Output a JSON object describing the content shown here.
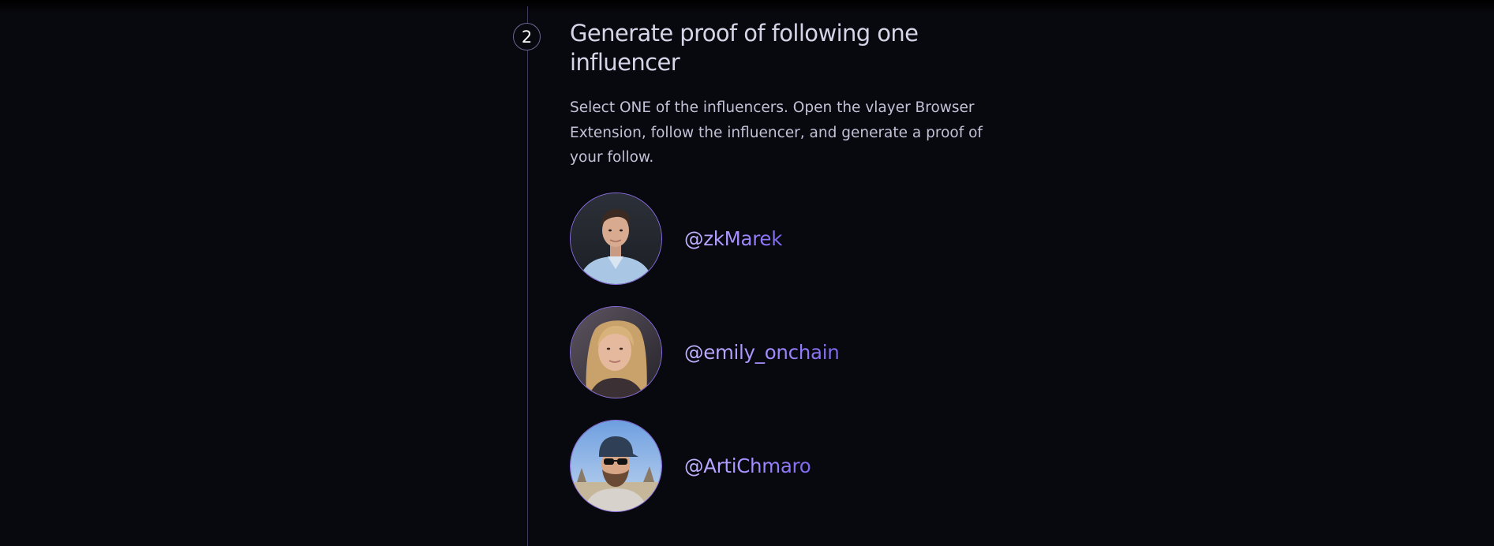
{
  "step": {
    "number": "2",
    "title": "Generate proof of following one influencer",
    "description": "Select ONE of the influencers. Open the vlayer Browser Extension, follow the influencer, and generate a proof of your follow."
  },
  "influencers": [
    {
      "handle": "@zkMarek",
      "avatar_icon": "avatar-photo"
    },
    {
      "handle": "@emily_onchain",
      "avatar_icon": "avatar-photo"
    },
    {
      "handle": "@ArtiChmaro",
      "avatar_icon": "avatar-photo"
    }
  ],
  "colors": {
    "background": "#08080f",
    "accent": "#a58dff",
    "text": "#d6d4e6"
  }
}
